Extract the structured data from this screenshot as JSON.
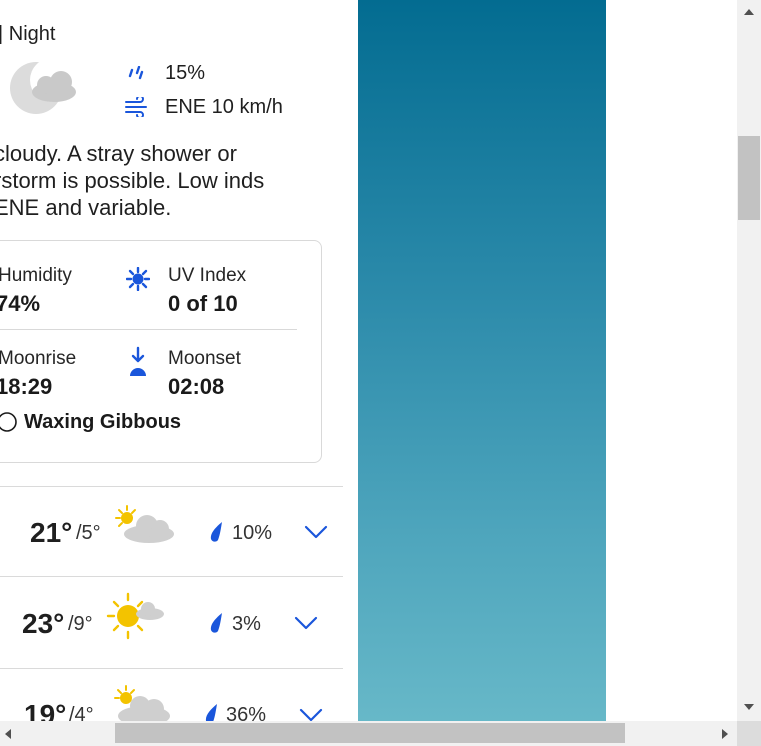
{
  "night": {
    "label": "| Night",
    "precip": "15%",
    "wind": "ENE 10 km/h",
    "description": "cloudy. A stray shower or rstorm is possible. Low inds ENE and variable."
  },
  "details": {
    "humidity_label": "Humidity",
    "humidity_value": "74%",
    "uv_label": "UV Index",
    "uv_value": "0 of 10",
    "moonrise_label": "Moonrise",
    "moonrise_value": "18:29",
    "moonset_label": "Moonset",
    "moonset_value": "02:08",
    "moon_phase": "Waxing Gibbous"
  },
  "forecast": [
    {
      "high": "21°",
      "low": "/5°",
      "precip": "10%",
      "icon": "partly-cloudy-icon"
    },
    {
      "high": "23°",
      "low": "/9°",
      "precip": "3%",
      "icon": "mostly-sunny-icon"
    },
    {
      "high": "19°",
      "low": "/4°",
      "precip": "36%",
      "icon": "partly-cloudy-icon"
    }
  ],
  "colors": {
    "accent": "#1a56db",
    "teal_top": "#036c91",
    "teal_bottom": "#67b8c8",
    "sun": "#f3c300"
  }
}
